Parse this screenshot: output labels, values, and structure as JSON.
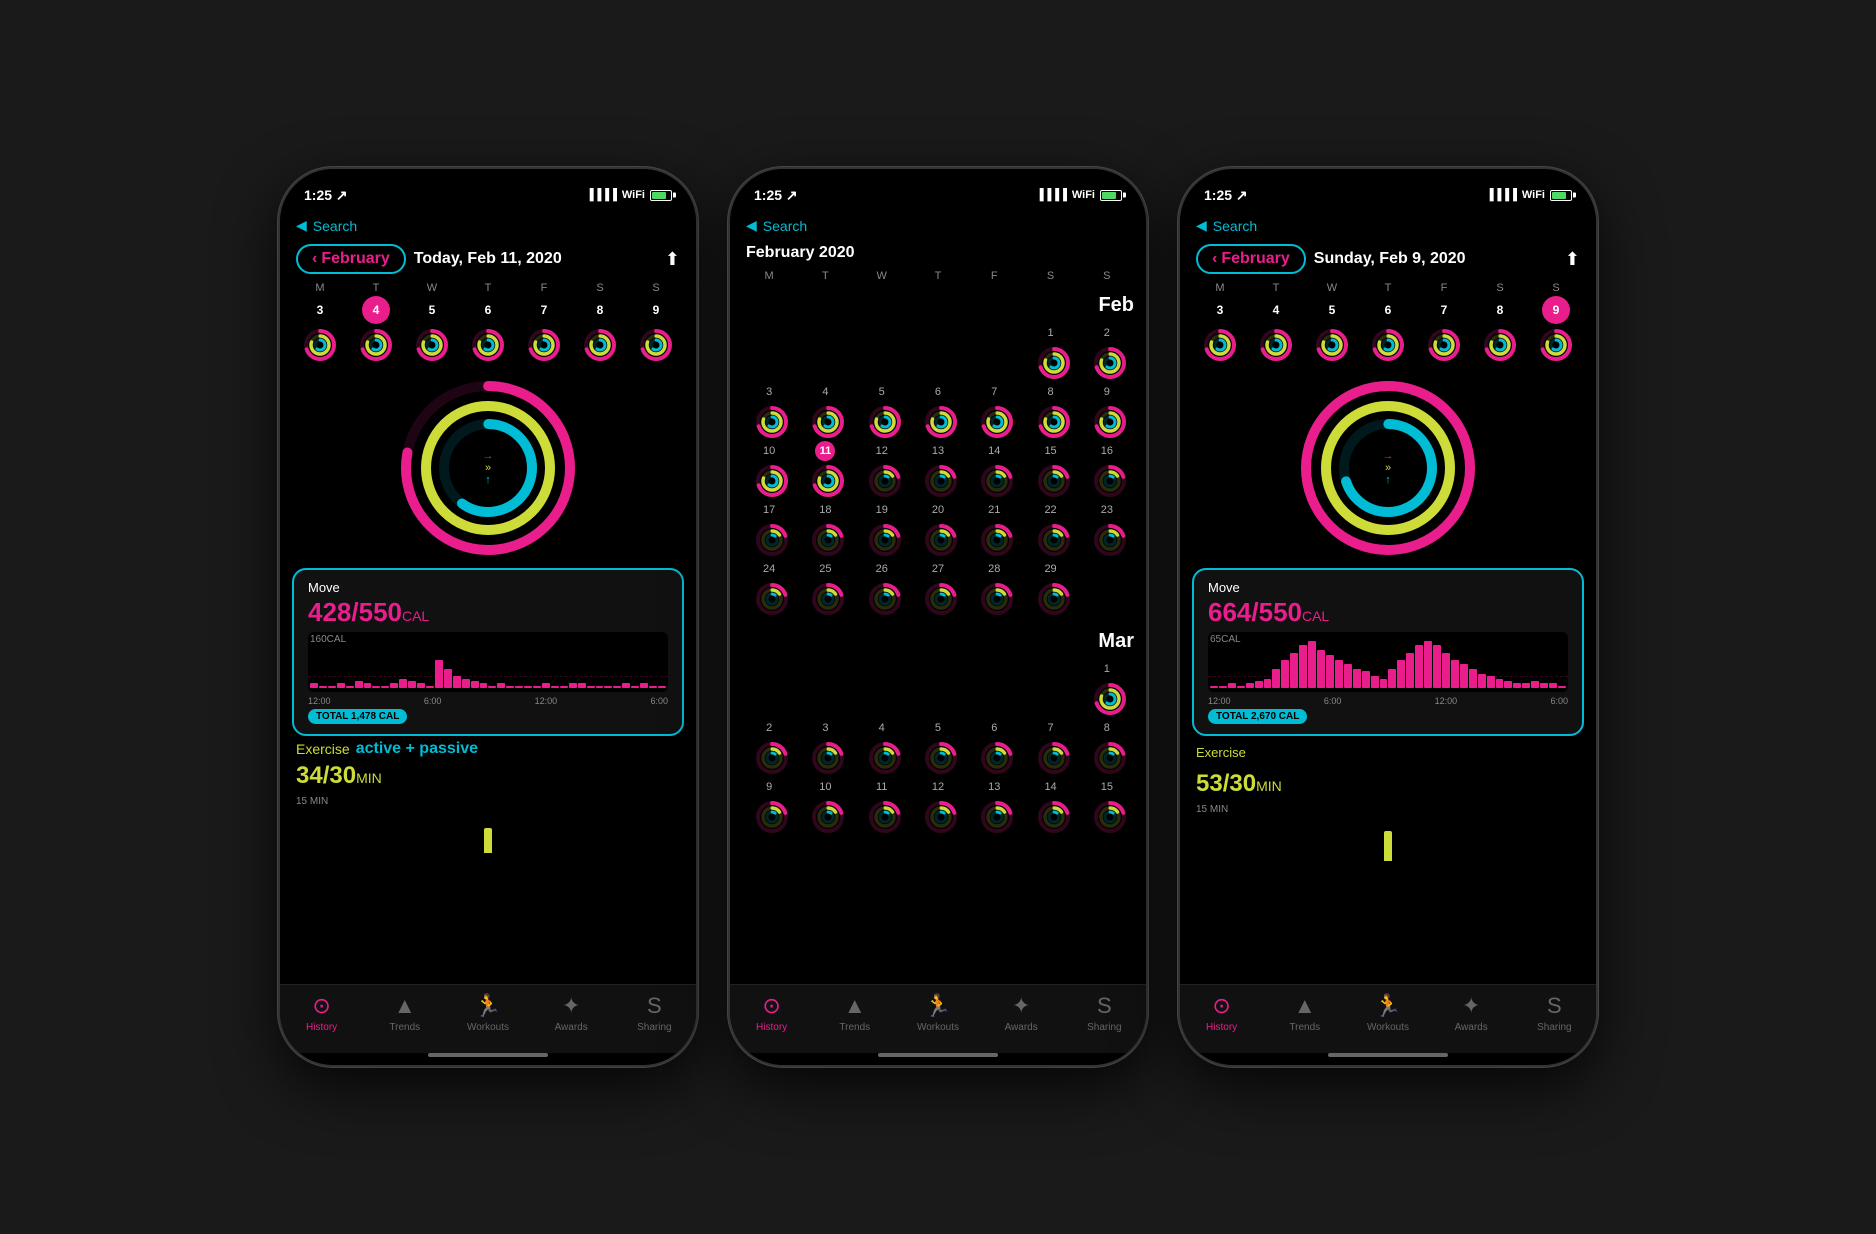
{
  "phones": [
    {
      "id": "phone1",
      "statusBar": {
        "time": "1:25",
        "signal": true,
        "wifi": true,
        "battery": true
      },
      "type": "detail",
      "nav": {
        "back": "◀",
        "backLabel": "Search"
      },
      "header": {
        "monthBtn": "February",
        "chevron": "‹",
        "dayTitle": "Today, Feb 11, 2020",
        "shareIcon": "↑"
      },
      "weekDays": [
        "M",
        "T",
        "W",
        "T",
        "F",
        "S",
        "S"
      ],
      "weekNumbers": [
        "3",
        "4",
        "5",
        "6",
        "7",
        "8",
        "9"
      ],
      "todayIndex": 1,
      "moveCard": {
        "label": "Move",
        "value": "428/550",
        "unit": "CAL",
        "calLabel": "160CAL",
        "times": [
          "12:00",
          "6:00",
          "12:00",
          "6:00"
        ],
        "total": "TOTAL 1,478 CAL"
      },
      "annotation": "active + passive",
      "exerciseCard": {
        "label": "Exercise",
        "value": "34/30",
        "unit": "MIN",
        "minLabel": "15 MIN"
      },
      "tabs": [
        {
          "icon": "⊙",
          "label": "History",
          "active": true
        },
        {
          "icon": "▲",
          "label": "Trends",
          "active": false
        },
        {
          "icon": "🏃",
          "label": "Workouts",
          "active": false
        },
        {
          "icon": "✦",
          "label": "Awards",
          "active": false
        },
        {
          "icon": "S",
          "label": "Sharing",
          "active": false
        }
      ]
    },
    {
      "id": "phone2",
      "statusBar": {
        "time": "1:25",
        "signal": true,
        "wifi": true,
        "battery": true
      },
      "type": "calendar",
      "nav": {
        "back": "◀",
        "backLabel": "Search"
      },
      "calHeader": "February 2020",
      "weekDayHeaders": [
        "M",
        "T",
        "W",
        "T",
        "F",
        "S",
        "S"
      ],
      "calMonths": [
        {
          "name": "Feb",
          "weeks": [
            [
              "",
              "",
              "",
              "",
              "",
              "1",
              "2"
            ],
            [
              "3",
              "4",
              "5",
              "6",
              "7",
              "8",
              "9"
            ],
            [
              "10",
              "11",
              "12",
              "13",
              "14",
              "15",
              "16"
            ],
            [
              "17",
              "18",
              "19",
              "20",
              "21",
              "22",
              "23"
            ],
            [
              "24",
              "25",
              "26",
              "27",
              "28",
              "29",
              ""
            ]
          ]
        },
        {
          "name": "Mar",
          "weeks": [
            [
              "",
              "",
              "",
              "",
              "",
              "",
              "1"
            ],
            [
              "2",
              "3",
              "4",
              "5",
              "6",
              "7",
              "8"
            ],
            [
              "9",
              "10",
              "11",
              "12",
              "13",
              "14",
              "15"
            ]
          ]
        }
      ],
      "tabs": [
        {
          "icon": "⊙",
          "label": "History",
          "active": true
        },
        {
          "icon": "▲",
          "label": "Trends",
          "active": false
        },
        {
          "icon": "🏃",
          "label": "Workouts",
          "active": false
        },
        {
          "icon": "✦",
          "label": "Awards",
          "active": false
        },
        {
          "icon": "S",
          "label": "Sharing",
          "active": false
        }
      ]
    },
    {
      "id": "phone3",
      "statusBar": {
        "time": "1:25",
        "signal": true,
        "wifi": true,
        "battery": true
      },
      "type": "detail",
      "nav": {
        "back": "◀",
        "backLabel": "Search"
      },
      "header": {
        "monthBtn": "February",
        "chevron": "‹",
        "dayTitle": "Sunday, Feb 9, 2020",
        "shareIcon": "↑"
      },
      "weekDays": [
        "M",
        "T",
        "W",
        "T",
        "F",
        "S",
        "S"
      ],
      "weekNumbers": [
        "3",
        "4",
        "5",
        "6",
        "7",
        "8",
        "9"
      ],
      "todayIndex": 6,
      "moveCard": {
        "label": "Move",
        "value": "664/550",
        "unit": "CAL",
        "calLabel": "65CAL",
        "times": [
          "12:00",
          "6:00",
          "12:00",
          "6:00"
        ],
        "total": "TOTAL 2,670 CAL"
      },
      "annotation": null,
      "exerciseCard": {
        "label": "Exercise",
        "value": "53/30",
        "unit": "MIN",
        "minLabel": "15 MIN"
      },
      "tabs": [
        {
          "icon": "⊙",
          "label": "History",
          "active": true
        },
        {
          "icon": "▲",
          "label": "Trends",
          "active": false
        },
        {
          "icon": "🏃",
          "label": "Workouts",
          "active": false
        },
        {
          "icon": "✦",
          "label": "Awards",
          "active": false
        },
        {
          "icon": "S",
          "label": "Sharing",
          "active": false
        }
      ]
    }
  ],
  "colors": {
    "move": "#e91e8c",
    "exercise": "#cddc39",
    "stand": "#00bcd4",
    "bg": "#000000",
    "tabBg": "#111111",
    "active": "#e91e8c"
  }
}
